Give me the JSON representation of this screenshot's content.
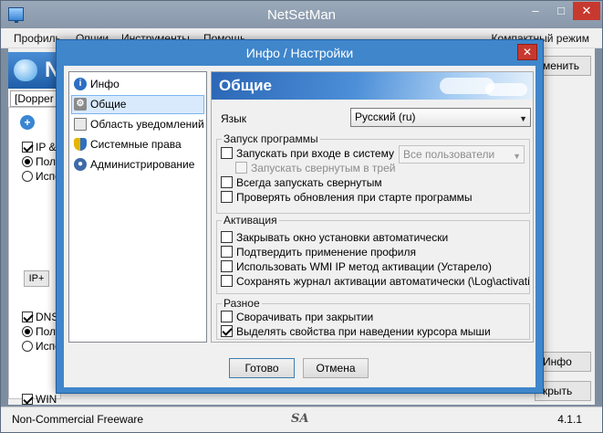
{
  "main": {
    "title": "NetSetMan",
    "menu": [
      "Профиль",
      "Опции",
      "Инструменты",
      "Помощь"
    ],
    "compact_mode": "Компактный режим",
    "brand_letter": "N",
    "profile_tab": "[Dopper",
    "left_rows": {
      "ip": "IP &",
      "ip_radio1": "Полу",
      "ip_radio2": "Испо",
      "ip_plus": "IP+",
      "dns": "DNS",
      "dns_radio1": "Полу",
      "dns_radio2": "Испо",
      "win": "WIN"
    },
    "right_buttons": {
      "change": "менить",
      "info": "Инфо",
      "close": "крыть"
    },
    "status_left": "Non-Commercial Freeware",
    "status_right": "4.1.1",
    "status_logo": "SA"
  },
  "dialog": {
    "title": "Инфо / Настройки",
    "close_glyph": "✕",
    "nav": [
      {
        "label": "Инфо",
        "icon": "info-icon"
      },
      {
        "label": "Общие",
        "icon": "gear-icon",
        "selected": true
      },
      {
        "label": "Область уведомлений",
        "icon": "window-icon"
      },
      {
        "label": "Системные права",
        "icon": "shield-icon"
      },
      {
        "label": "Администрирование",
        "icon": "user-icon"
      }
    ],
    "header": "Общие",
    "language": {
      "label": "Язык",
      "value": "Русский (ru)"
    },
    "startup": {
      "title": "Запуск программы",
      "launch_at_login": "Запускать при входе в систему",
      "launch_at_login_checked": false,
      "users_select": "Все пользователи",
      "launch_minimized_tray": "Запускать свернутым в трей",
      "always_minimized": "Всегда запускать свернутым",
      "always_minimized_checked": false,
      "check_updates": "Проверять обновления при старте программы",
      "check_updates_checked": false
    },
    "activation": {
      "title": "Активация",
      "auto_close_window": "Закрывать окно установки автоматически",
      "confirm_profile": "Подтвердить применение профиля",
      "wmi_method": "Использовать WMI IP метод активации (Устарело)",
      "save_log": "Сохранять журнал активации автоматически (\\Log\\activationlog"
    },
    "misc": {
      "title": "Разное",
      "minimize_on_close": "Сворачивать при закрытии",
      "minimize_on_close_checked": false,
      "highlight_properties": "Выделять свойства при наведении курсора мыши",
      "highlight_properties_checked": true
    },
    "buttons": {
      "ok": "Готово",
      "cancel": "Отмена"
    }
  }
}
